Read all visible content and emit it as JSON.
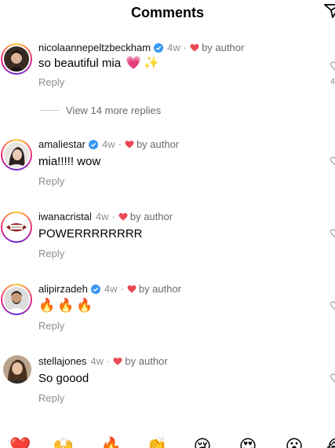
{
  "header": {
    "title": "Comments",
    "share_icon": "paper-plane-icon"
  },
  "comments": [
    {
      "username": "nicolaannepeltzbeckham",
      "verified": true,
      "age": "4w",
      "separator": "·",
      "liked_by_author": "by author",
      "text": "so beautiful mia",
      "text_emojis": [
        "💗",
        "✨"
      ],
      "reply_label": "Reply",
      "right_count": "4"
    },
    {
      "username": "amaliestar",
      "verified": true,
      "age": "4w",
      "separator": "·",
      "liked_by_author": "by author",
      "text": "mia!!!!! wow",
      "reply_label": "Reply"
    },
    {
      "username": "iwanacristal",
      "verified": false,
      "age": "4w",
      "separator": "·",
      "liked_by_author": "by author",
      "text": "POWERRRRRRRR",
      "reply_label": "Reply"
    },
    {
      "username": "alipirzadeh",
      "verified": true,
      "age": "4w",
      "separator": "·",
      "liked_by_author": "by author",
      "text": "",
      "text_emojis": [
        "🔥",
        "🔥",
        "🔥"
      ],
      "reply_label": "Reply"
    },
    {
      "username": "stellajones",
      "verified": false,
      "age": "4w",
      "separator": "·",
      "liked_by_author": "by author",
      "text": "So goood",
      "reply_label": "Reply"
    }
  ],
  "view_more": {
    "label": "View 14 more replies"
  },
  "emoji_bar": [
    "❤️",
    "🙌",
    "🔥",
    "👏",
    "😢",
    "😍",
    "😮",
    "😂"
  ],
  "colors": {
    "heart": "#ed4956",
    "verified": "#3897f0",
    "muted": "#8e8e8e"
  }
}
